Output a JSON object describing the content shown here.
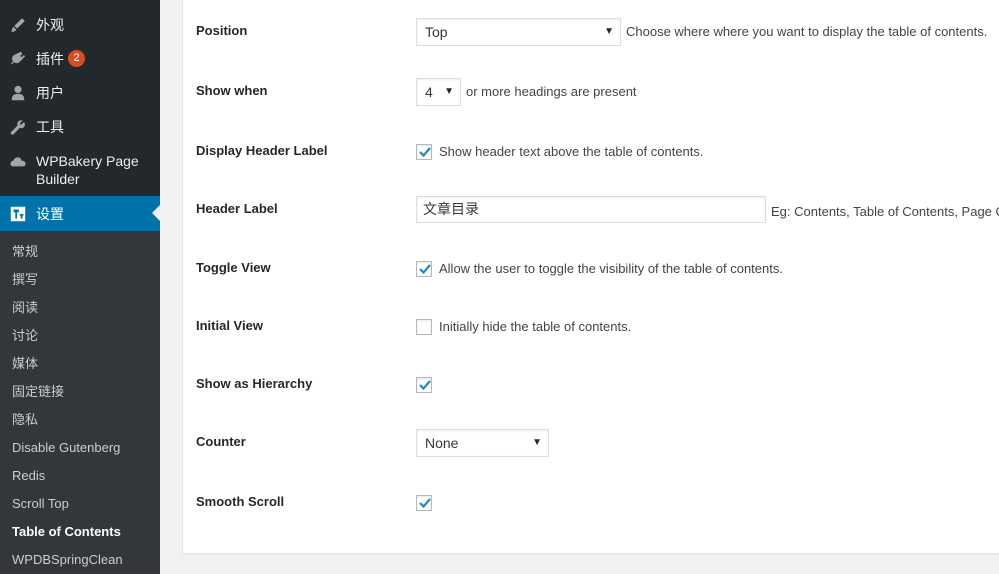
{
  "sidebar": {
    "menu": [
      {
        "label": "外观",
        "icon": "paintbrush-icon"
      },
      {
        "label": "插件",
        "icon": "plugin-icon",
        "badge": "2"
      },
      {
        "label": "用户",
        "icon": "user-icon"
      },
      {
        "label": "工具",
        "icon": "wrench-icon"
      },
      {
        "label": "WPBakery Page Builder",
        "icon": "cloud-icon"
      },
      {
        "label": "设置",
        "icon": "settings-icon",
        "active": true
      }
    ],
    "submenu": [
      {
        "label": "常规"
      },
      {
        "label": "撰写"
      },
      {
        "label": "阅读"
      },
      {
        "label": "讨论"
      },
      {
        "label": "媒体"
      },
      {
        "label": "固定链接"
      },
      {
        "label": "隐私"
      },
      {
        "label": "Disable Gutenberg"
      },
      {
        "label": "Redis"
      },
      {
        "label": "Scroll Top"
      },
      {
        "label": "Table of Contents",
        "current": true
      },
      {
        "label": "WPDBSpringClean"
      }
    ]
  },
  "settings": {
    "position": {
      "label": "Position",
      "value": "Top",
      "description": "Choose where where you want to display the table of contents."
    },
    "show_when": {
      "label": "Show when",
      "value": "4",
      "suffix": "or more headings are present"
    },
    "display_header_label": {
      "label": "Display Header Label",
      "checked": true,
      "text": "Show header text above the table of contents."
    },
    "header_label": {
      "label": "Header Label",
      "value": "文章目录",
      "hint": "Eg: Contents, Table of Contents, Page Contents"
    },
    "toggle_view": {
      "label": "Toggle View",
      "checked": true,
      "text": "Allow the user to toggle the visibility of the table of contents."
    },
    "initial_view": {
      "label": "Initial View",
      "checked": false,
      "text": "Initially hide the table of contents."
    },
    "show_as_hierarchy": {
      "label": "Show as Hierarchy",
      "checked": true
    },
    "counter": {
      "label": "Counter",
      "value": "None"
    },
    "smooth_scroll": {
      "label": "Smooth Scroll",
      "checked": true
    }
  },
  "colors": {
    "accent": "#0073aa",
    "sidebar_bg": "#23282d",
    "submenu_bg": "#32373c",
    "badge": "#d54e21",
    "checkbox_tick": "#1e8cbe"
  }
}
